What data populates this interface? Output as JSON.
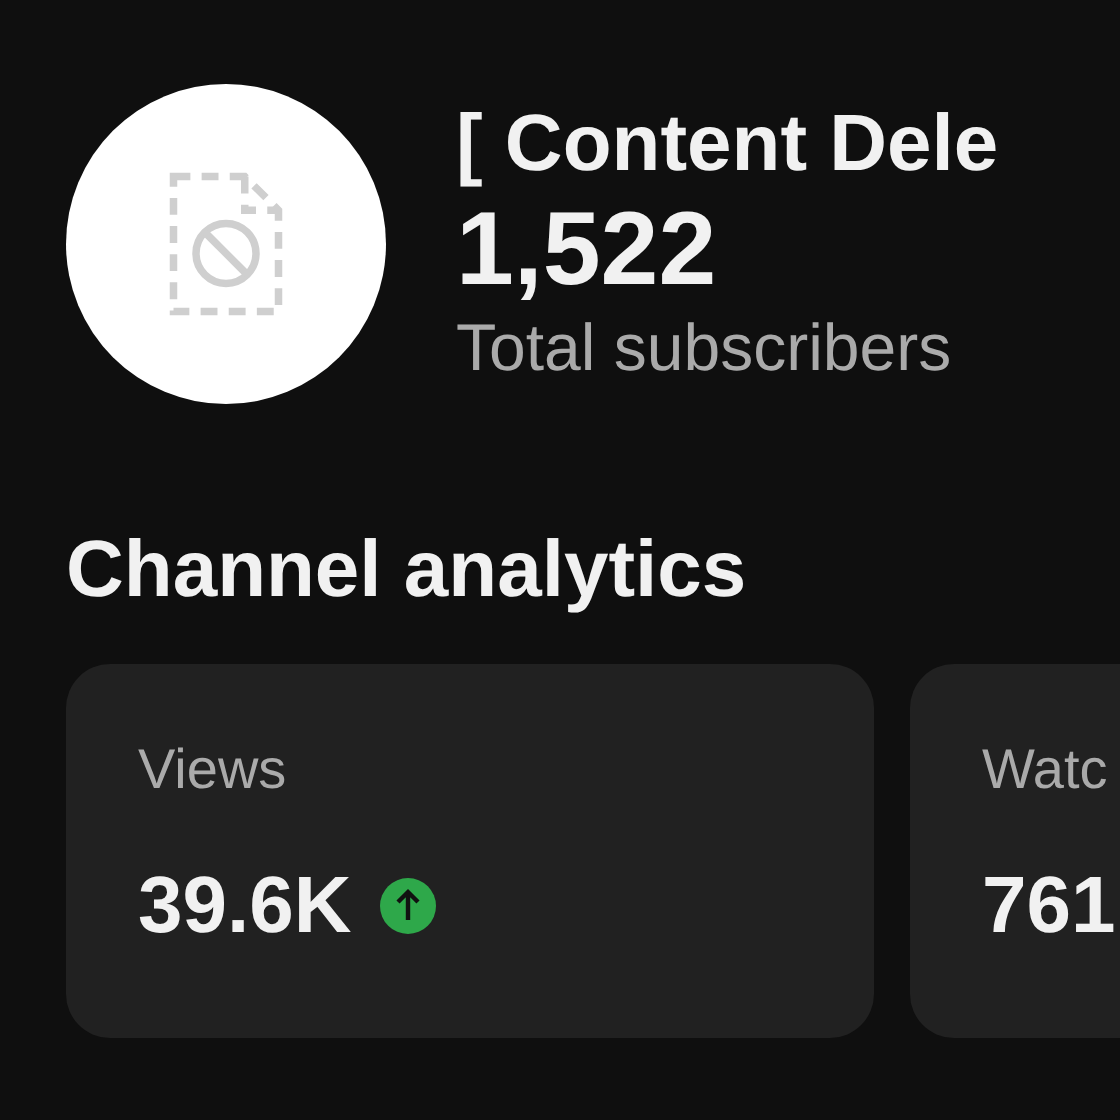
{
  "channel": {
    "name": "[ Content Dele",
    "subscriber_count": "1,522",
    "subscriber_label": "Total subscribers"
  },
  "analytics": {
    "title": "Channel analytics",
    "cards": [
      {
        "label": "Views",
        "value": "39.6K",
        "rising": true
      },
      {
        "label": "Watc",
        "value": "761"
      }
    ]
  }
}
